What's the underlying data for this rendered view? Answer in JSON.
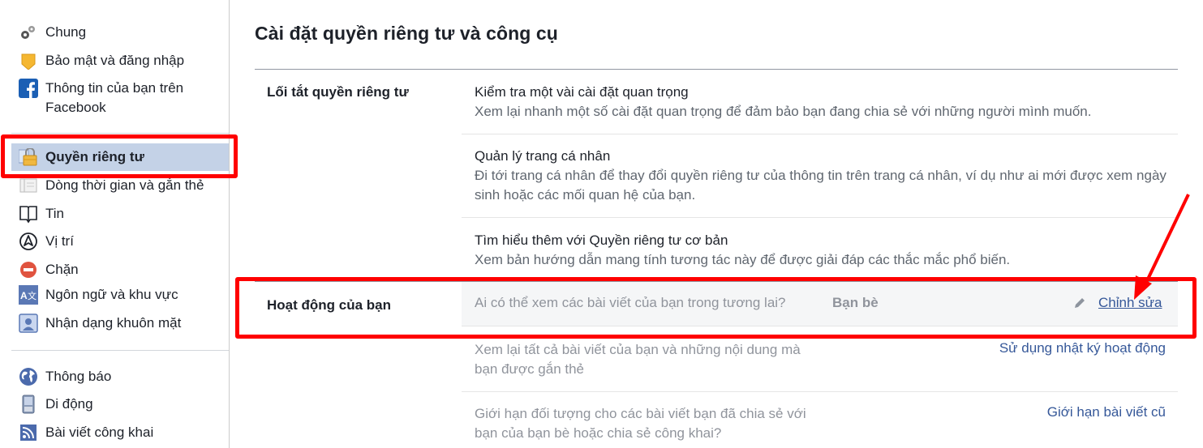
{
  "sidebar": {
    "items": [
      {
        "label": "Chung",
        "icon": "gears-icon"
      },
      {
        "label": "Bảo mật và đăng nhập",
        "icon": "shield-badge-icon"
      },
      {
        "label": "Thông tin của bạn trên Facebook",
        "icon": "facebook-icon"
      },
      {
        "label": "Quyền riêng tư",
        "icon": "padlock-icon",
        "active": true
      },
      {
        "label": "Dòng thời gian và gắn thẻ",
        "icon": "timeline-icon"
      },
      {
        "label": "Tin",
        "icon": "book-icon"
      },
      {
        "label": "Vị trí",
        "icon": "location-icon"
      },
      {
        "label": "Chặn",
        "icon": "block-icon"
      },
      {
        "label": "Ngôn ngữ và khu vực",
        "icon": "language-icon"
      },
      {
        "label": "Nhận dạng khuôn mặt",
        "icon": "face-recognition-icon"
      },
      {
        "label": "Thông báo",
        "icon": "globe-icon"
      },
      {
        "label": "Di động",
        "icon": "mobile-icon"
      },
      {
        "label": "Bài viết công khai",
        "icon": "rss-icon"
      }
    ]
  },
  "main": {
    "title": "Cài đặt quyền riêng tư và công cụ",
    "shortcuts": {
      "label": "Lối tắt quyền riêng tư",
      "items": [
        {
          "title": "Kiểm tra một vài cài đặt quan trọng",
          "desc": "Xem lại nhanh một số cài đặt quan trọng để đảm bảo bạn đang chia sẻ với những người mình muốn."
        },
        {
          "title": "Quản lý trang cá nhân",
          "desc": "Đi tới trang cá nhân để thay đổi quyền riêng tư của thông tin trên trang cá nhân, ví dụ như ai mới được xem ngày sinh hoặc các mối quan hệ của bạn."
        },
        {
          "title": "Tìm hiểu thêm với Quyền riêng tư cơ bản",
          "desc": "Xem bản hướng dẫn mang tính tương tác này để được giải đáp các thắc mắc phổ biến."
        }
      ]
    },
    "activity": {
      "label": "Hoạt động của bạn",
      "future_posts": {
        "question": "Ai có thể xem các bài viết của bạn trong tương lai?",
        "value": "Bạn bè",
        "edit_label": "Chỉnh sửa"
      },
      "review": {
        "desc": "Xem lại tất cả bài viết của bạn và những nội dung mà bạn được gắn thẻ",
        "action": "Sử dụng nhật ký hoạt động"
      },
      "limit": {
        "desc": "Giới hạn đối tượng cho các bài viết bạn đã chia sẻ với bạn của bạn bè hoặc chia sẻ công khai?",
        "action": "Giới hạn bài viết cũ"
      }
    }
  },
  "colors": {
    "annotation": "#ff0000",
    "link": "#365899",
    "active_bg": "#c4d2e7"
  }
}
